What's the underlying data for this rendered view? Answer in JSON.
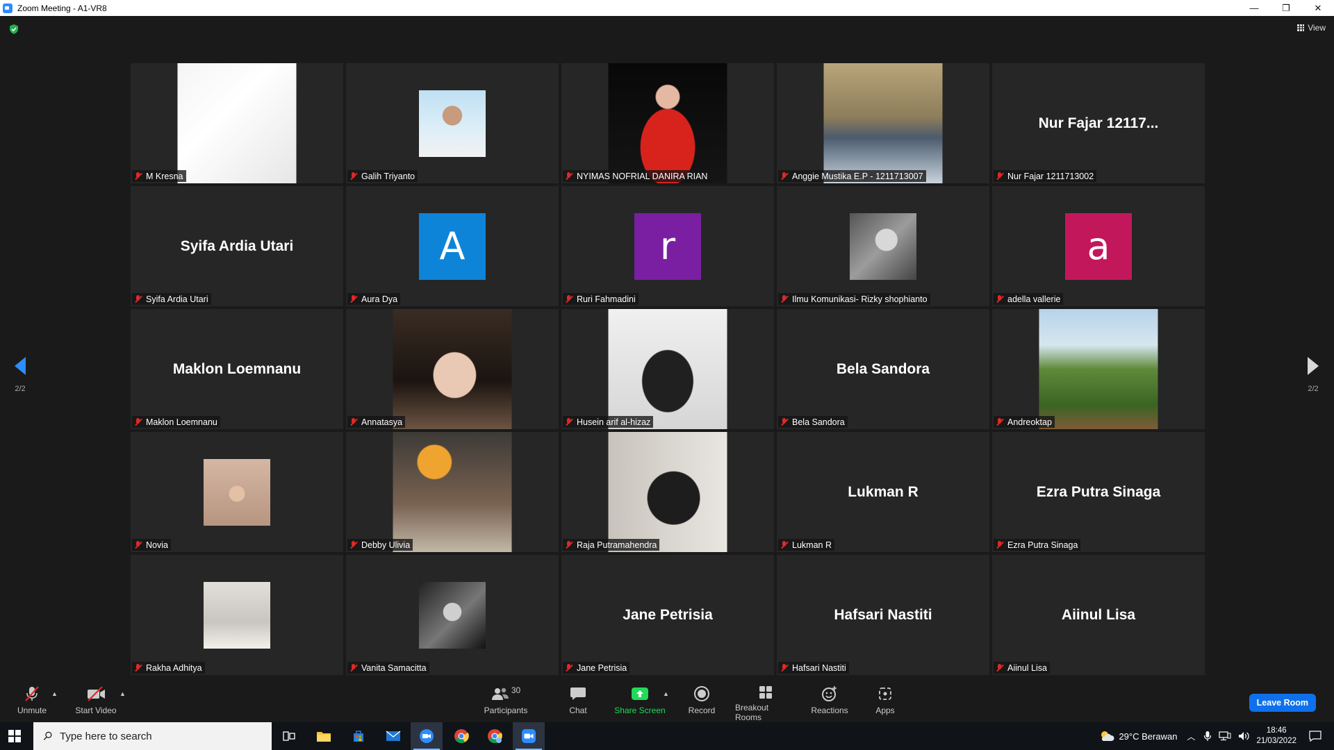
{
  "window": {
    "title": "Zoom Meeting - A1-VR8",
    "controls": [
      "—",
      "❐",
      "✕"
    ]
  },
  "view_button": {
    "label": "View"
  },
  "pager": {
    "left": "2/2",
    "right": "2/2"
  },
  "participants": [
    {
      "tile_name": "M Kresna",
      "display": "photo",
      "photo_style": "white"
    },
    {
      "tile_name": "Galih Triyanto",
      "display": "thumb",
      "photo_style": "man-white-shirt"
    },
    {
      "tile_name": "NYIMAS NOFRIAL DANIRA RIAN",
      "display": "photo",
      "photo_style": "red-dress"
    },
    {
      "tile_name": "Anggie Mustika E.P - 1211713007",
      "display": "photo",
      "photo_style": "curtain-posters"
    },
    {
      "tile_name": "Nur Fajar 1211713002",
      "display": "text",
      "big_name": "Nur Fajar 12117..."
    },
    {
      "tile_name": "Syifa Ardia Utari",
      "display": "text",
      "big_name": "Syifa Ardia Utari"
    },
    {
      "tile_name": "Aura Dya",
      "display": "avatar",
      "letter": "A",
      "color": "#0e84d8"
    },
    {
      "tile_name": "Ruri Fahmadini",
      "display": "avatar",
      "letter": "r",
      "color": "#7b1fa2"
    },
    {
      "tile_name": "Ilmu Komunikasi- Rizky shophianto",
      "display": "thumb",
      "photo_style": "bw-man"
    },
    {
      "tile_name": "adella vallerie",
      "display": "avatar",
      "letter": "a",
      "color": "#c2185b"
    },
    {
      "tile_name": "Maklon Loemnanu",
      "display": "text",
      "big_name": "Maklon Loemnanu"
    },
    {
      "tile_name": "Annatasya",
      "display": "photo",
      "photo_style": "selfie-girl"
    },
    {
      "tile_name": "Husein arif al-hizaz",
      "display": "photo",
      "photo_style": "manga"
    },
    {
      "tile_name": "Bela Sandora",
      "display": "text",
      "big_name": "Bela Sandora"
    },
    {
      "tile_name": "Andreoktap",
      "display": "photo",
      "photo_style": "hill-green"
    },
    {
      "tile_name": "Novia",
      "display": "thumb",
      "photo_style": "hijab"
    },
    {
      "tile_name": "Debby Ulivia",
      "display": "photo",
      "photo_style": "cafe-lamp"
    },
    {
      "tile_name": "Raja Putramahendra",
      "display": "photo",
      "photo_style": "man-reading"
    },
    {
      "tile_name": "Lukman R",
      "display": "text",
      "big_name": "Lukman R"
    },
    {
      "tile_name": "Ezra Putra Sinaga",
      "display": "text",
      "big_name": "Ezra Putra Sinaga"
    },
    {
      "tile_name": "Rakha Adhitya",
      "display": "thumb",
      "photo_style": "baby-keyboard"
    },
    {
      "tile_name": "Vanita Samacitta",
      "display": "thumb",
      "photo_style": "bw-portrait"
    },
    {
      "tile_name": "Jane Petrisia",
      "display": "text",
      "big_name": "Jane Petrisia"
    },
    {
      "tile_name": "Hafsari Nastiti",
      "display": "text",
      "big_name": "Hafsari Nastiti"
    },
    {
      "tile_name": "Aiinul Lisa",
      "display": "text",
      "big_name": "Aiinul Lisa"
    }
  ],
  "toolbar": {
    "unmute": "Unmute",
    "start_video": "Start Video",
    "participants": "Participants",
    "participants_count": "30",
    "chat": "Chat",
    "share_screen": "Share Screen",
    "record": "Record",
    "breakout_rooms": "Breakout Rooms",
    "reactions": "Reactions",
    "apps": "Apps",
    "leave_room": "Leave Room",
    "share_color": "#23d959"
  },
  "taskbar": {
    "search_placeholder": "Type here to search",
    "weather": "29°C  Berawan",
    "time": "18:46",
    "date": "21/03/2022"
  }
}
